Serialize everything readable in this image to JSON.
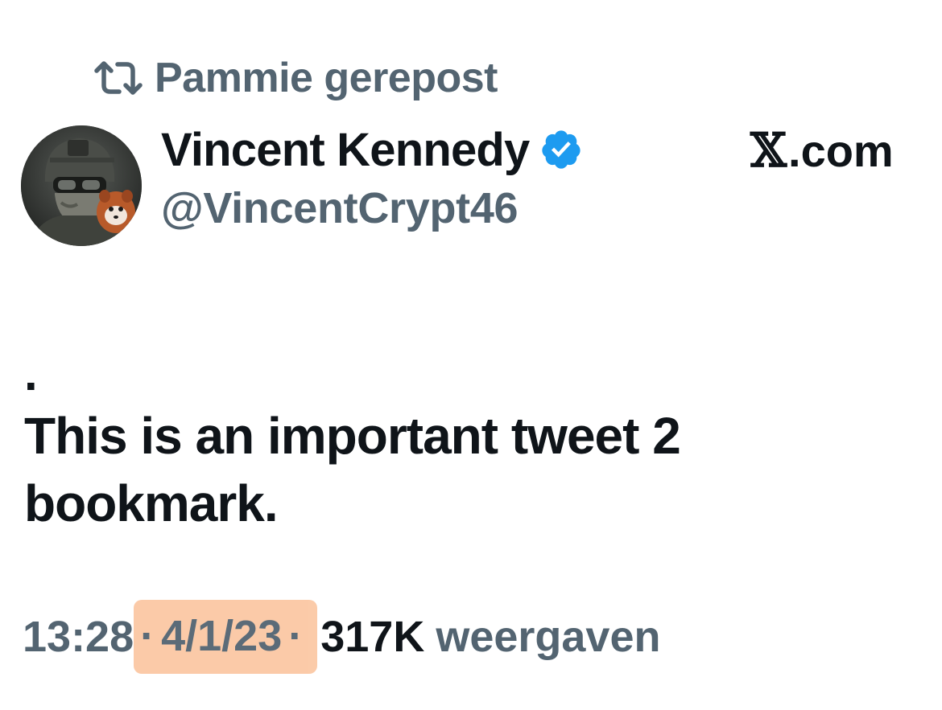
{
  "repost": {
    "icon": "repost-icon",
    "label": "Pammie gerepost"
  },
  "author": {
    "display_name": "Vincent Kennedy",
    "verified_icon": "verified-badge-icon",
    "verified_color": "#1d9bf0",
    "handle": "@VincentCrypt46",
    "avatar": "avatar-image"
  },
  "source": {
    "label": ".com",
    "logo": "𝕏"
  },
  "tweet": {
    "lead": ".",
    "text": "This is an important tweet 2 bookmark."
  },
  "meta": {
    "time": "13:28",
    "separator": "·",
    "date": "4/1/23",
    "views_count": "317K",
    "views_label": "weergaven",
    "highlight_color": "#fbc8a4",
    "muted_color": "#536471"
  }
}
